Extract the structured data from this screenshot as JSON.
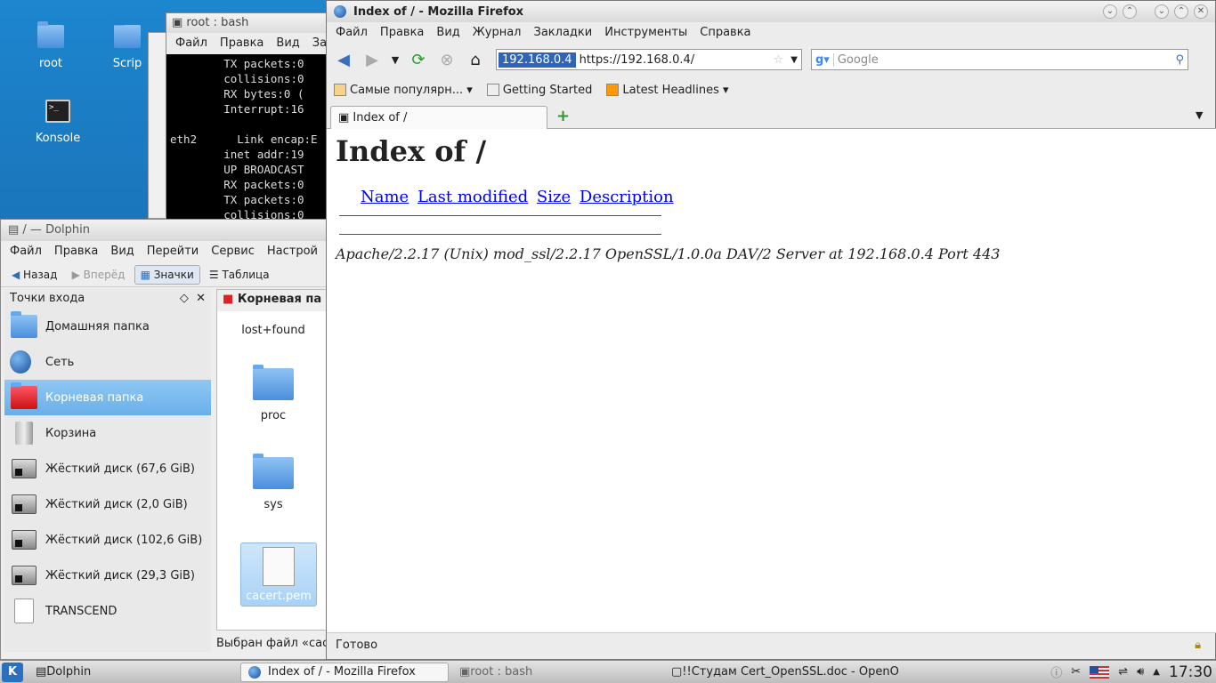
{
  "desktop": {
    "icons": [
      {
        "label": "root"
      },
      {
        "label": "Scrip"
      },
      {
        "label": "Konsole"
      }
    ]
  },
  "konsole": {
    "title": "root : bash",
    "menu": [
      "Файл",
      "Правка",
      "Вид",
      "За"
    ],
    "lines": [
      "        TX packets:0",
      "        collisions:0",
      "        RX bytes:0 (",
      "        Interrupt:16",
      "",
      "eth2      Link encap:E",
      "        inet addr:19",
      "        UP BROADCAST",
      "        RX packets:0",
      "        TX packets:0",
      "        collisions:0"
    ]
  },
  "dolphin": {
    "title": "/ — Dolphin",
    "menu": [
      "Файл",
      "Правка",
      "Вид",
      "Перейти",
      "Сервис",
      "Настрой"
    ],
    "toolbar": {
      "back": "Назад",
      "forward": "Вперёд",
      "icons": "Значки",
      "table": "Таблица"
    },
    "places_title": "Точки входа",
    "places": [
      {
        "label": "Домашняя папка"
      },
      {
        "label": "Сеть"
      },
      {
        "label": "Корневая папка"
      },
      {
        "label": "Корзина"
      },
      {
        "label": "Жёсткий диск (67,6 GiB)"
      },
      {
        "label": "Жёсткий диск (2,0 GiB)"
      },
      {
        "label": "Жёсткий диск (102,6 GiB)"
      },
      {
        "label": "Жёсткий диск (29,3 GiB)"
      },
      {
        "label": "TRANSCEND"
      }
    ],
    "location": "Корневая па",
    "files": [
      "lost+found",
      "proc",
      "sys",
      "cacert.pem"
    ],
    "status": "Выбран файл «cac"
  },
  "firefox": {
    "title": "Index of / - Mozilla Firefox",
    "menu": [
      "Файл",
      "Правка",
      "Вид",
      "Журнал",
      "Закладки",
      "Инструменты",
      "Справка"
    ],
    "url_host": "192.168.0.4",
    "url": "https://192.168.0.4/",
    "search_placeholder": "Google",
    "bookmarks": [
      "Самые популярн...",
      "Getting Started",
      "Latest Headlines"
    ],
    "tab_title": "Index of /",
    "page": {
      "heading": "Index of /",
      "columns": [
        "Name",
        "Last modified",
        "Size",
        "Description"
      ],
      "address": "Apache/2.2.17 (Unix) mod_ssl/2.2.17 OpenSSL/1.0.0a DAV/2 Server at 192.168.0.4 Port 443"
    },
    "status": "Готово"
  },
  "taskbar": {
    "tasks": [
      "Dolphin",
      "Index of / - Mozilla Firefox",
      "root : bash",
      "!!Студам Cert_OpenSSL.doc - OpenO"
    ],
    "clock": "17:30"
  }
}
